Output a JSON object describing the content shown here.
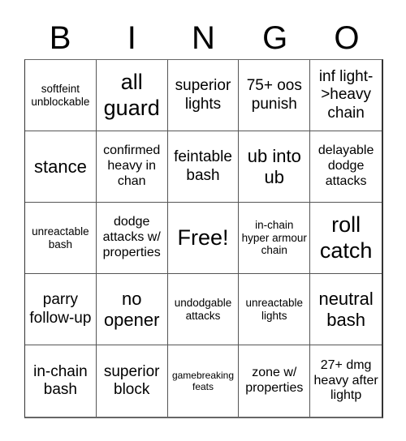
{
  "header": [
    "B",
    "I",
    "N",
    "G",
    "O"
  ],
  "cells": [
    "softfeint unblockable",
    "all guard",
    "superior lights",
    "75+ oos punish",
    "inf light->heavy chain",
    "stance",
    "confirmed heavy in chan",
    "feintable bash",
    "ub into ub",
    "delayable dodge attacks",
    "unreactable bash",
    "dodge attacks w/ properties",
    "Free!",
    "in-chain hyper armour chain",
    "roll catch",
    "parry follow-up",
    "no opener",
    "undodgable attacks",
    "unreactable lights",
    "neutral bash",
    "in-chain bash",
    "superior block",
    "gamebreaking feats",
    "zone w/ properties",
    "27+ dmg heavy after lightp"
  ]
}
